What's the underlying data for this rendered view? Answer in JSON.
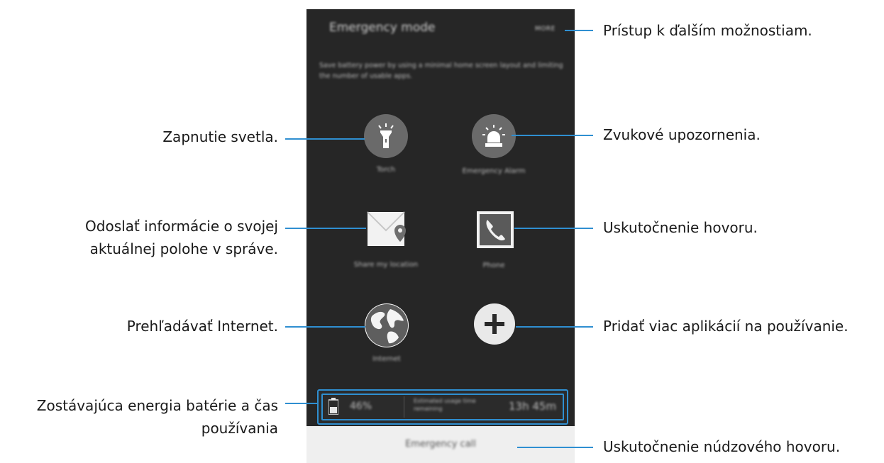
{
  "screen": {
    "title": "Emergency mode",
    "more_label": "MORE",
    "description": "Save battery power by using a minimal home screen layout and limiting the number of usable apps.",
    "apps": [
      {
        "id": "torch",
        "label": "Torch",
        "icon": "torch-icon"
      },
      {
        "id": "alarm",
        "label": "Emergency Alarm",
        "icon": "siren-icon"
      },
      {
        "id": "share",
        "label": "Share my location",
        "icon": "envelope-location-icon"
      },
      {
        "id": "phone",
        "label": "Phone",
        "icon": "phone-icon"
      },
      {
        "id": "internet",
        "label": "Internet",
        "icon": "globe-icon"
      },
      {
        "id": "add",
        "label": "",
        "icon": "plus-icon"
      }
    ],
    "battery": {
      "percent": "46%",
      "estimated_label": "Estimated usage time remaining",
      "time": "13h 45m"
    },
    "emergency_call_label": "Emergency call"
  },
  "annotations": {
    "more": "Prístup k ďalším možnostiam.",
    "torch": "Zapnutie svetla.",
    "alarm": "Zvukové upozornenia.",
    "share_line1": "Odoslať informácie o svojej",
    "share_line2": "aktuálnej polohe v správe.",
    "phone": "Uskutočnenie hovoru.",
    "internet": "Prehľadávať Internet.",
    "add": "Pridať viac aplikácií na používanie.",
    "battery_line1": "Zostávajúca energia batérie a čas",
    "battery_line2": "používania",
    "emergency_call": "Uskutočnenie núdzového hovoru."
  },
  "colors": {
    "accent": "#2f8fd1",
    "screen_bg": "#262626",
    "icon_bg": "#6a6a6a"
  }
}
